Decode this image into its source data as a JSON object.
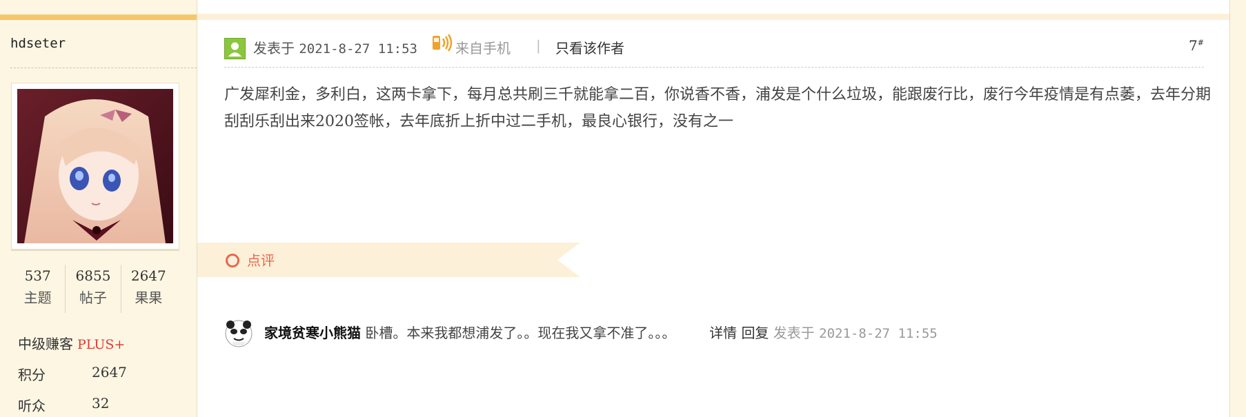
{
  "sidebar": {
    "username": "hdseter",
    "stats": [
      {
        "value": "537",
        "label": "主题"
      },
      {
        "value": "6855",
        "label": "帖子"
      },
      {
        "value": "2647",
        "label": "果果"
      }
    ],
    "level": {
      "label": "中级赚客",
      "badge": "PLUS+"
    },
    "points": {
      "label": "积分",
      "value": "2647"
    },
    "listeners": {
      "label": "听众",
      "value": "32"
    }
  },
  "post": {
    "posted_prefix": "发表于",
    "posted_time": "2021-8-27 11:53",
    "from_phone": "来自手机",
    "separator": "|",
    "only_author": "只看该作者",
    "floor": "7",
    "floor_mark": "#",
    "body": "广发犀利金，多利白，这两卡拿下，每月总共刷三千就能拿二百，你说香不香，浦发是个什么垃圾，能跟废行比，废行今年疫情是有点萎，去年分期刮刮乐刮出来2020签帐，去年底折上折中过二手机，最良心银行，没有之一"
  },
  "comments_section": {
    "title": "点评",
    "items": [
      {
        "author": "家境贫寒小熊猫",
        "text": "卧槽。本来我都想浦发了。。现在我又拿不准了。。。",
        "detail": "详情",
        "reply": "回复",
        "posted_prefix": "发表于",
        "posted_time": "2021-8-27 11:55"
      }
    ]
  },
  "colors": {
    "sidebar_bg": "#fdf6e3",
    "accent_orange": "#f8c66a",
    "ribbon_bg": "#fdf0d8",
    "ribbon_text": "#e8674e",
    "plus_red": "#e03a2f",
    "user_icon_green": "#8cc63f"
  }
}
